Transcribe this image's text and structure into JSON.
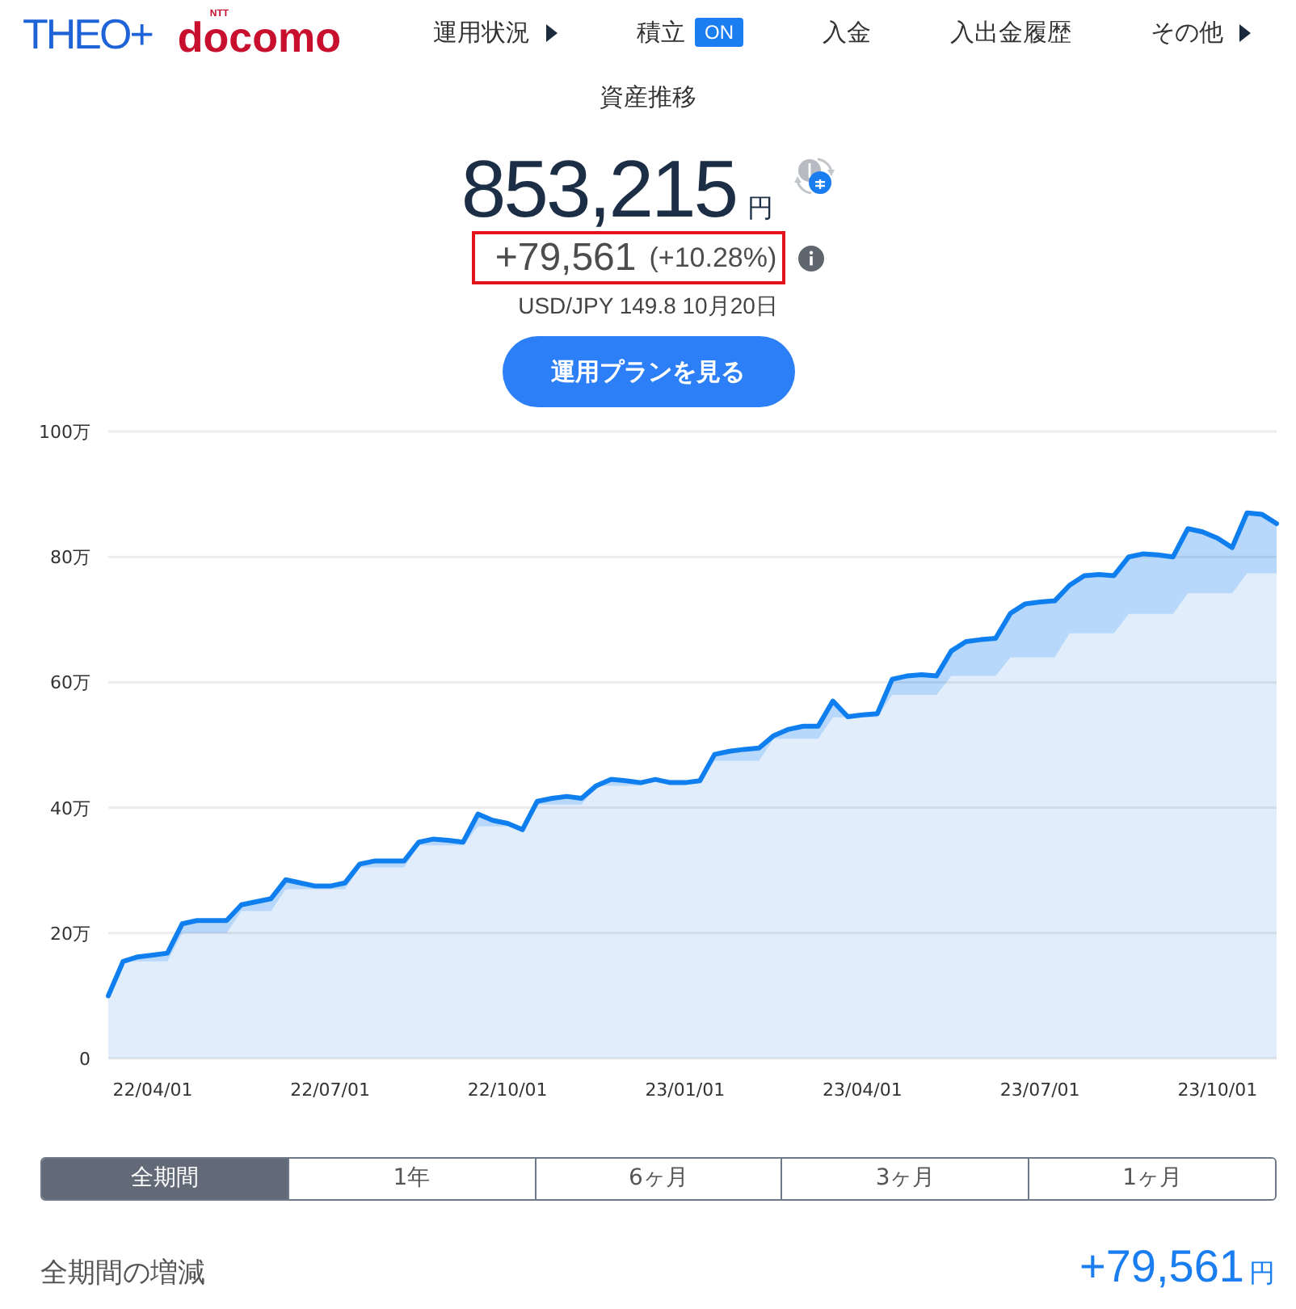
{
  "header": {
    "logo": {
      "brand": "THEO+",
      "partner_mark": "NTT",
      "partner": "docomo"
    },
    "nav": [
      {
        "label": "運用状況",
        "kind": "menu"
      },
      {
        "label": "積立",
        "kind": "toggle",
        "badge": "ON"
      },
      {
        "label": "入金",
        "kind": "link"
      },
      {
        "label": "入出金履歴",
        "kind": "link"
      },
      {
        "label": "その他",
        "kind": "menu"
      }
    ]
  },
  "summary": {
    "title": "資産推移",
    "total": "853,215",
    "total_unit": "円",
    "change": "+79,561",
    "change_rate": "(+10.28%)",
    "change_highlighted": true,
    "exchange_rate": "USD/JPY 149.8 10月20日",
    "button": "運用プランを見る"
  },
  "chart": {
    "chart_data": {
      "type": "area",
      "grid": true,
      "categories": [
        null,
        null,
        null,
        "22/04/01",
        null,
        null,
        null,
        null,
        null,
        null,
        null,
        null,
        null,
        null,
        null,
        "22/07/01",
        null,
        null,
        null,
        null,
        null,
        null,
        null,
        null,
        null,
        null,
        null,
        "22/10/01",
        null,
        null,
        null,
        null,
        null,
        null,
        null,
        null,
        null,
        null,
        null,
        "23/01/01",
        null,
        null,
        null,
        null,
        null,
        null,
        null,
        null,
        null,
        null,
        null,
        "23/04/01",
        null,
        null,
        null,
        null,
        null,
        null,
        null,
        null,
        null,
        null,
        null,
        "23/07/01",
        null,
        null,
        null,
        null,
        null,
        null,
        null,
        null,
        null,
        null,
        null,
        "23/10/01",
        null,
        null,
        null,
        null
      ],
      "series": [
        {
          "color": "#0f7ff0",
          "values": [
            10,
            15.5,
            16.2,
            16.5,
            16.8,
            21.5,
            22,
            22,
            22,
            24.5,
            25,
            25.5,
            28.5,
            28,
            27.5,
            27.5,
            28,
            31,
            31.5,
            31.5,
            31.5,
            34.5,
            35,
            34.8,
            34.5,
            39,
            38,
            37.5,
            36.5,
            41,
            41.5,
            41.8,
            41.5,
            43.5,
            44.5,
            44.3,
            44,
            44.5,
            44,
            44,
            44.3,
            48.5,
            49,
            49.3,
            49.5,
            51.5,
            52.5,
            53,
            53,
            57,
            54.5,
            54.8,
            55,
            60.5,
            61,
            61.2,
            61,
            65,
            66.5,
            66.8,
            67,
            71,
            72.5,
            72.8,
            73,
            75.5,
            77,
            77.2,
            77,
            80,
            80.5,
            80.3,
            80,
            84.5,
            84,
            83,
            81.5,
            87,
            86.8,
            85.3
          ]
        },
        {
          "color": "#e1edfa",
          "values": [
            10,
            15.5,
            15.5,
            15.5,
            15.5,
            20,
            20,
            20,
            20,
            23.5,
            23.5,
            23.5,
            27,
            27,
            27,
            27,
            27,
            30.5,
            30.5,
            30.5,
            30.5,
            34,
            34,
            34,
            34,
            37,
            37,
            37,
            37,
            40.5,
            40.5,
            40.5,
            40.5,
            43.5,
            43.5,
            43.5,
            43.5,
            44.5,
            44.5,
            44.5,
            44.5,
            47.5,
            47.5,
            47.5,
            47.5,
            51,
            51,
            51,
            51,
            54.4,
            54.4,
            54.4,
            54.4,
            58,
            58,
            58,
            58,
            61,
            61,
            61,
            61,
            64,
            64,
            64,
            64,
            67.8,
            67.8,
            67.8,
            67.8,
            70.9,
            70.9,
            70.9,
            70.9,
            74.2,
            74.2,
            74.2,
            74.2,
            77.4,
            77.4,
            77.4
          ]
        }
      ],
      "ylim": [
        0,
        100
      ],
      "yticks": [
        0,
        {
          "value": 20,
          "label": "20万"
        },
        {
          "value": 40,
          "label": "40万"
        },
        {
          "value": 60,
          "label": "60万"
        },
        {
          "value": 80,
          "label": "80万"
        },
        {
          "value": 100,
          "label": "100万"
        }
      ]
    }
  },
  "period_tabs": [
    {
      "label": "全期間",
      "selected": true
    },
    {
      "label": "1年",
      "selected": false
    },
    {
      "label": "6ヶ月",
      "selected": false
    },
    {
      "label": "3ヶ月",
      "selected": false
    },
    {
      "label": "1ヶ月",
      "selected": false
    }
  ],
  "footer": {
    "label": "全期間の増減",
    "value": "+79,561",
    "unit": "円"
  }
}
